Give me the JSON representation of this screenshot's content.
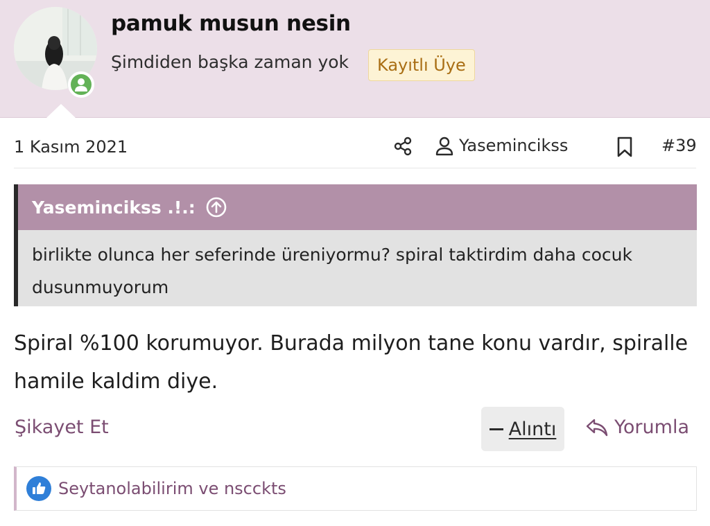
{
  "header": {
    "username": "pamuk musun nesin",
    "user_title": "Şimdiden başka zaman yok",
    "user_badge": "Kayıtlı Üye"
  },
  "meta": {
    "date": "1 Kasım 2021",
    "author": "Yasemincikss",
    "post_number": "#39"
  },
  "quote": {
    "author": "Yasemincikss .!.:",
    "text": "birlikte olunca her seferinde üreniyormu? spiral taktirdim daha cocuk dusunmuyorum"
  },
  "message": {
    "text": "Spiral %100 korumuyor. Burada milyon tane konu vardır, spiralle hamile kaldim diye."
  },
  "actions": {
    "report_label": "Şikayet Et",
    "quote_label": "Alıntı",
    "reply_label": "Yorumla"
  },
  "reactions": {
    "users": "Seytanolabilirim ve nscckts"
  },
  "icons": {
    "online": "person-icon",
    "share": "share-icon",
    "author": "user-icon",
    "bookmark": "bookmark-icon",
    "quote_jump": "arrow-up-circle-icon",
    "reply": "reply-arrow-icon",
    "like": "thumbs-up-icon"
  },
  "colors": {
    "header_bg": "#ecdfe8",
    "quote_head_bg": "#b290a8",
    "link": "#7b4d72",
    "badge_bg": "#fdf3d5",
    "badge_text": "#a96e14",
    "online": "#63b257",
    "like": "#2f7fd8"
  }
}
